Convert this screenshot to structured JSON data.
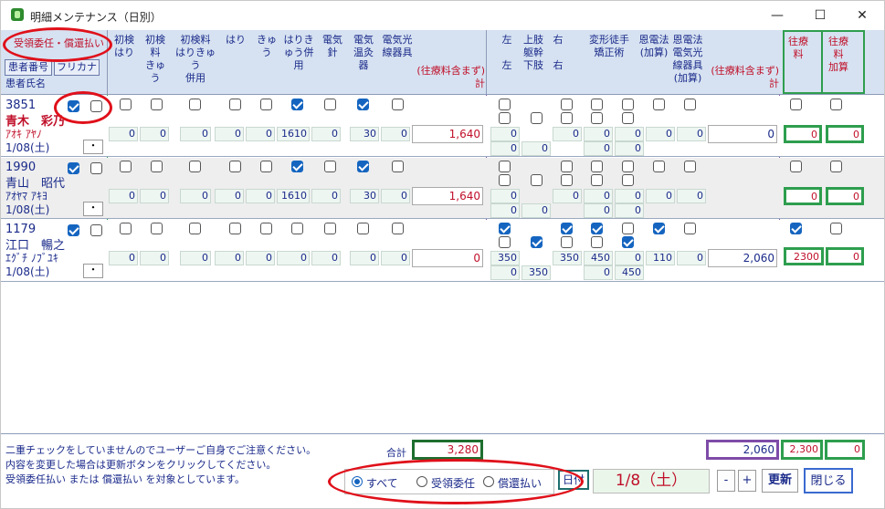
{
  "window": {
    "title": "明細メンテナンス（日別）",
    "min": "—",
    "max": "☐",
    "close": "✕"
  },
  "header": {
    "payment_type": "受領委任・償還払い",
    "btn_patient_no": "患者番号",
    "btn_kana": "フリカナ",
    "patient_name": "患者氏名",
    "cols": [
      "初検\nはり",
      "初検\n料\nきゅ\nう",
      "初検料\nはりきゅ\nう\n併用",
      "はり",
      "きゅ\nう",
      "はりき\nゅう併\n用",
      "電気\n針",
      "電気\n温灸\n器",
      "電気光\n線器具"
    ],
    "subtotal_a": "(往療料含まず)\n計",
    "cols2": [
      "左\n\n左",
      "上肢\n躯幹\n下肢",
      "右\n\n右",
      "変形徒手\n矯正術",
      "恩電法\n(加算)",
      "恩電法\n電気光\n線器具\n(加算)"
    ],
    "subtotal_b": "(往療料含まず)\n計",
    "ory": "往療\n料",
    "ory_add": "往療\n料\n加算"
  },
  "rows": [
    {
      "id": "3851",
      "name": "青木　彩乃",
      "kana": "ｱｵｷ ｱﾔﾉ",
      "date": "1/08(土)",
      "dot": "・",
      "vals": [
        "0",
        "0",
        "0",
        "0",
        "0",
        "1610",
        "0",
        "30",
        "0"
      ],
      "total": "1,640",
      "v2a": [
        "0",
        "0",
        "0",
        "0",
        "0",
        "0"
      ],
      "v2b": [
        "0",
        "0",
        "0",
        "0"
      ],
      "total2": "0",
      "ory": "0",
      "oryadd": "0"
    },
    {
      "id": "1990",
      "name": "青山　昭代",
      "kana": "ｱｵﾔﾏ ｱｷﾖ",
      "date": "1/08(土)",
      "dot": "・",
      "vals": [
        "0",
        "0",
        "0",
        "0",
        "0",
        "1610",
        "0",
        "30",
        "0"
      ],
      "total": "1,640",
      "v2a": [
        "0",
        "0",
        "0",
        "0",
        "0",
        "0"
      ],
      "v2b": [
        "0",
        "0",
        "0",
        "0"
      ],
      "total2": "",
      "ory": "0",
      "oryadd": "0"
    },
    {
      "id": "1179",
      "name": "江口　暢之",
      "kana": "ｴｸﾞﾁ ﾉﾌﾞﾕｷ",
      "date": "1/08(土)",
      "dot": "・",
      "vals": [
        "0",
        "0",
        "0",
        "0",
        "0",
        "0",
        "0",
        "0",
        "0"
      ],
      "total": "0",
      "v2a": [
        "350",
        "",
        "350",
        "450",
        "0",
        "110",
        "0"
      ],
      "v2b": [
        "0",
        "350",
        "0",
        "450"
      ],
      "total2": "2,060",
      "ory": "2300",
      "oryadd": "0"
    }
  ],
  "footer": {
    "notes": [
      "二重チェックをしていませんのでユーザーご自身でご注意ください。",
      "内容を変更した場合は更新ボタンをクリックしてください。",
      "受領委任払い または 償還払い を対象としています。"
    ],
    "sum_label": "合計",
    "sum": "3,280",
    "sum2": "2,060",
    "sum_ory": "2,300",
    "sum_oryadd": "0",
    "radio_all": "すべて",
    "radio_juryo": "受領委任",
    "radio_shokan": "償還払い",
    "date_label": "日付",
    "date": "1/8（土）",
    "minus": "-",
    "plus": "+",
    "update": "更新",
    "close": "閉じる"
  }
}
